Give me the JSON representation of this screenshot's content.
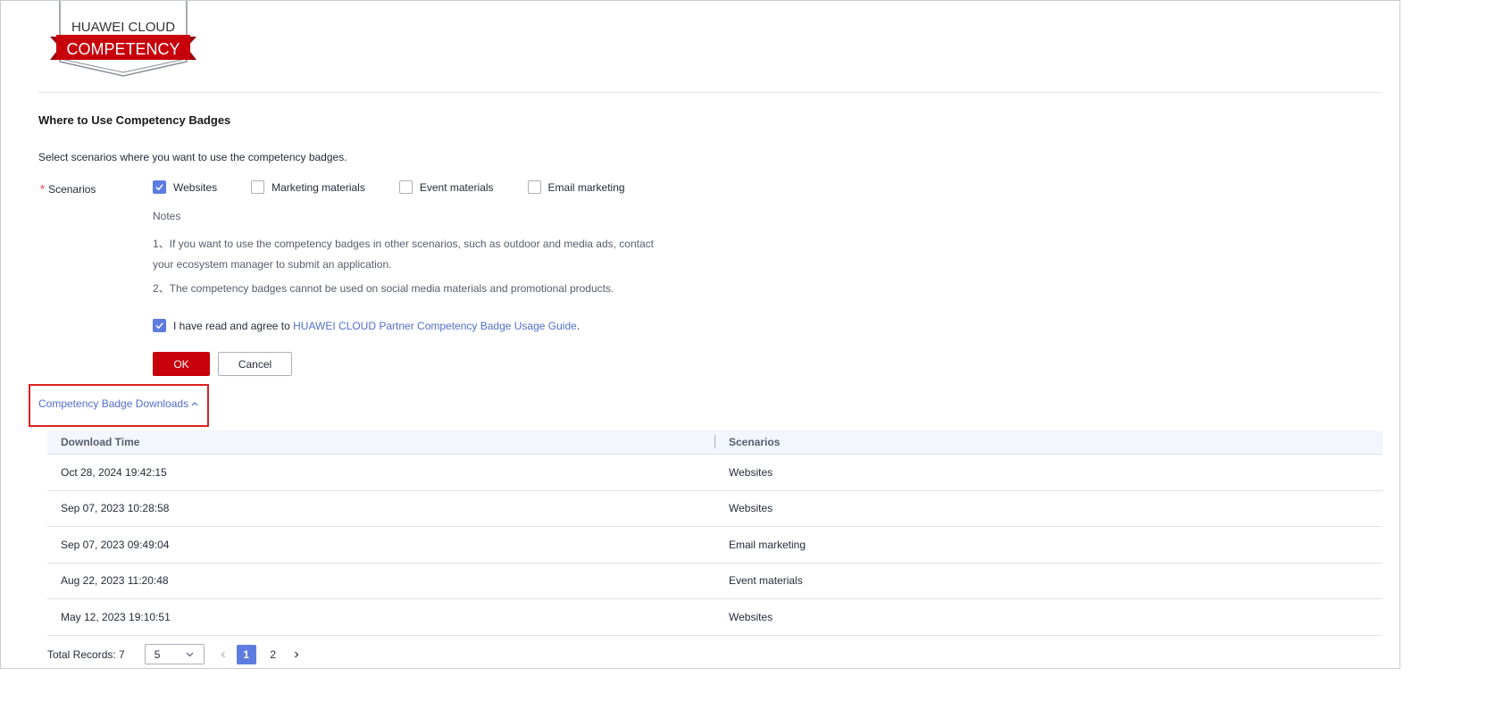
{
  "logo": {
    "line1": "HUAWEI CLOUD",
    "line2": "COMPETENCY"
  },
  "section": {
    "title": "Where to Use Competency Badges",
    "description": "Select scenarios where you want to use the competency badges."
  },
  "form": {
    "required_mark": "*",
    "label": "Scenarios",
    "options": [
      {
        "label": "Websites",
        "checked": true
      },
      {
        "label": "Marketing materials",
        "checked": false
      },
      {
        "label": "Event materials",
        "checked": false
      },
      {
        "label": "Email marketing",
        "checked": false
      }
    ],
    "notes_title": "Notes",
    "notes": [
      "1、If you want to use the competency badges in other scenarios, such as outdoor and media ads, contact your ecosystem manager to submit an application.",
      "2、The competency badges cannot be used on social media materials and promotional products."
    ],
    "agree_text": "I have read and agree to ",
    "agree_link": "HUAWEI CLOUD Partner Competency Badge Usage Guide",
    "agree_end": ".",
    "ok_label": "OK",
    "cancel_label": "Cancel"
  },
  "downloads": {
    "toggle_label": "Competency Badge Downloads",
    "columns": [
      "Download Time",
      "Scenarios"
    ],
    "rows": [
      {
        "time": "Oct 28, 2024 19:42:15",
        "scenario": "Websites"
      },
      {
        "time": "Sep 07, 2023 10:28:58",
        "scenario": "Websites"
      },
      {
        "time": "Sep 07, 2023 09:49:04",
        "scenario": "Email marketing"
      },
      {
        "time": "Aug 22, 2023 11:20:48",
        "scenario": "Event materials"
      },
      {
        "time": "May 12, 2023 19:10:51",
        "scenario": "Websites"
      }
    ]
  },
  "pagination": {
    "total_label": "Total Records: 7",
    "page_size": "5",
    "pages": [
      "1",
      "2"
    ],
    "current_page": "1"
  },
  "colors": {
    "brand_red": "#c7000b",
    "accent_blue": "#5e7ce0",
    "link_blue": "#526ecc",
    "highlight_red": "#e02020"
  }
}
